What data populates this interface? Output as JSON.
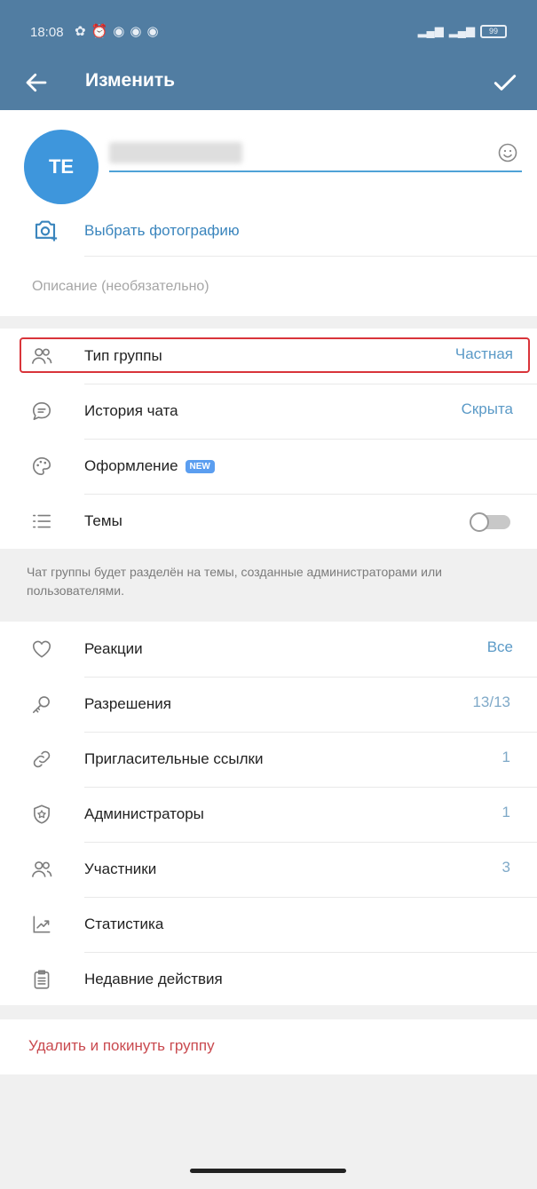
{
  "status": {
    "time": "18:08",
    "battery": "99"
  },
  "appbar": {
    "title": "Изменить"
  },
  "group": {
    "avatar_initials": "TE",
    "select_photo": "Выбрать фотографию",
    "description_placeholder": "Описание (необязательно)"
  },
  "settings": {
    "group_type": {
      "label": "Тип группы",
      "value": "Частная"
    },
    "chat_history": {
      "label": "История чата",
      "value": "Скрыта"
    },
    "appearance": {
      "label": "Оформление",
      "badge": "NEW"
    },
    "topics": {
      "label": "Темы",
      "enabled": false
    },
    "topics_hint": "Чат группы будет разделён на темы, созданные администраторами или пользователями."
  },
  "management": {
    "reactions": {
      "label": "Реакции",
      "value": "Все"
    },
    "permissions": {
      "label": "Разрешения",
      "value": "13/13"
    },
    "invite_links": {
      "label": "Пригласительные ссылки",
      "value": "1"
    },
    "admins": {
      "label": "Администраторы",
      "value": "1"
    },
    "members": {
      "label": "Участники",
      "value": "3"
    },
    "statistics": {
      "label": "Статистика"
    },
    "recent_actions": {
      "label": "Недавние действия"
    }
  },
  "danger": {
    "delete_leave": "Удалить и покинуть группу"
  },
  "colors": {
    "header": "#517da2",
    "accent": "#3a85bd",
    "danger": "#c94a4f",
    "avatar": "#3e96dc"
  }
}
